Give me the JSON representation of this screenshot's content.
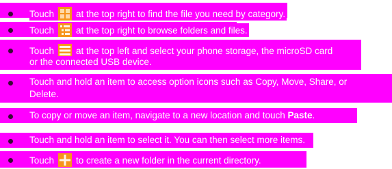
{
  "items": [
    {
      "before": "Touch",
      "icon": "category-grid-icon",
      "after": "at the top right to find the file you need by category."
    },
    {
      "before": "Touch",
      "icon": "folder-list-icon",
      "after": "at the top right to browse folders and files."
    },
    {
      "before": "Touch",
      "icon": "menu-icon",
      "after": "at the top left and select your phone storage, the microSD card",
      "line2": "or the connected USB device."
    },
    {
      "line1": "Touch and hold an item to access option icons such as Copy, Move, Share, or",
      "line2": "Delete."
    },
    {
      "before": "To copy or move an item, navigate to a new location and touch",
      "bold": "Paste",
      "after": "."
    },
    {
      "text": "Touch and hold an item to select it. You can then select more items."
    },
    {
      "before": "Touch",
      "icon": "add-icon",
      "after": "to create a new folder in the current directory."
    }
  ],
  "colors": {
    "highlight": "#ff00ff",
    "icon_orange": "#f7941d",
    "text": "#ffffff"
  }
}
